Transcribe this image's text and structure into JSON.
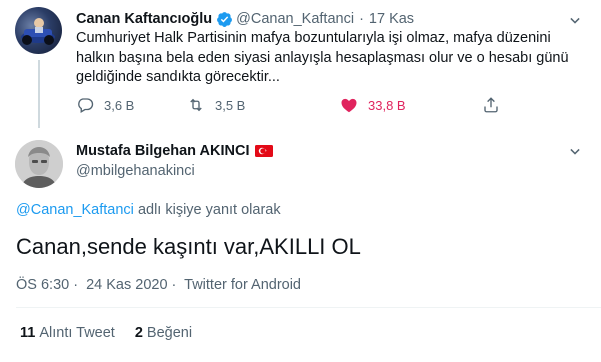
{
  "parent_tweet": {
    "name": "Canan Kaftancıoğlu",
    "handle": "@Canan_Kaftanci",
    "separator": "·",
    "date": "17 Kas",
    "text": "Cumhuriyet Halk Partisinin mafya bozuntularıyla işi olmaz, mafya düzenini halkın başına bela eden siyasi anlayışla hesaplaşması olur ve o hesabı günü geldiğinde sandıkta görecektir...",
    "replies": "3,6 B",
    "retweets": "3,5 B",
    "likes": "33,8 B",
    "liked": true,
    "colors": {
      "like": "#e0245e",
      "verified": "#1d9bf0"
    }
  },
  "main_tweet": {
    "name": "Mustafa Bilgehan AKINCI",
    "handle": "@mbilgehanakinci",
    "reply_mention": "@Canan_Kaftanci",
    "reply_suffix": "adlı kişiye yanıt olarak",
    "text": "Canan,sende kaşıntı var,AKILLI OL",
    "time": "ÖS 6:30",
    "meta_separator": "·",
    "date": "24 Kas 2020",
    "source": "Twitter for Android",
    "retweet_count": "11",
    "retweet_label": "Alıntı Tweet",
    "like_count": "2",
    "like_label": "Beğeni",
    "flag_icon": "turkey-flag-icon"
  }
}
